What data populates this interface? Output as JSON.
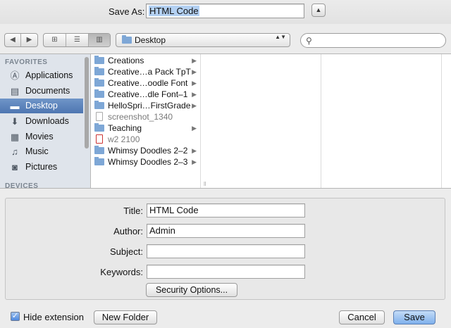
{
  "save_as": {
    "label": "Save As:",
    "value": "HTML Code",
    "expand_glyph": "▲"
  },
  "toolbar": {
    "nav": [
      "◀",
      "▶"
    ],
    "views": [
      "⊞",
      "☰",
      "▥"
    ],
    "location": "Desktop",
    "location_arrows": "▲▼",
    "search_icon": "⚲",
    "search_placeholder": ""
  },
  "sidebar": {
    "favorites_heading": "FAVORITES",
    "devices_heading": "DEVICES",
    "items": [
      {
        "label": "Applications",
        "icon": "applications-icon",
        "glyph": "Ⓐ"
      },
      {
        "label": "Documents",
        "icon": "documents-icon",
        "glyph": "▤"
      },
      {
        "label": "Desktop",
        "icon": "desktop-icon",
        "glyph": "▬"
      },
      {
        "label": "Downloads",
        "icon": "downloads-icon",
        "glyph": "⬇"
      },
      {
        "label": "Movies",
        "icon": "movies-icon",
        "glyph": "▦"
      },
      {
        "label": "Music",
        "icon": "music-icon",
        "glyph": "♫"
      },
      {
        "label": "Pictures",
        "icon": "pictures-icon",
        "glyph": "◙"
      }
    ]
  },
  "files": [
    {
      "name": "Creations",
      "type": "folder"
    },
    {
      "name": "Creative…a Pack TpT",
      "type": "folder"
    },
    {
      "name": "Creative…oodle Font",
      "type": "folder"
    },
    {
      "name": "Creative…dle Font–1",
      "type": "folder"
    },
    {
      "name": "HelloSpri…FirstGrade",
      "type": "folder"
    },
    {
      "name": "screenshot_1340",
      "type": "doc"
    },
    {
      "name": "Teaching",
      "type": "folder"
    },
    {
      "name": "w2 2100",
      "type": "pdf"
    },
    {
      "name": "Whimsy Doodles 2–2",
      "type": "folder"
    },
    {
      "name": "Whimsy Doodles 2–3",
      "type": "folder"
    }
  ],
  "arrow_glyph": "▶",
  "resize_glyph": "ll",
  "form": {
    "title_label": "Title:",
    "title_value": "HTML Code",
    "author_label": "Author:",
    "author_value": "Admin",
    "subject_label": "Subject:",
    "subject_value": "",
    "keywords_label": "Keywords:",
    "keywords_value": "",
    "security_button": "Security Options..."
  },
  "bottom": {
    "hide_extension_label": "Hide extension",
    "hide_extension_checked": true,
    "check_glyph": "✓",
    "new_folder": "New Folder",
    "cancel": "Cancel",
    "save": "Save"
  }
}
